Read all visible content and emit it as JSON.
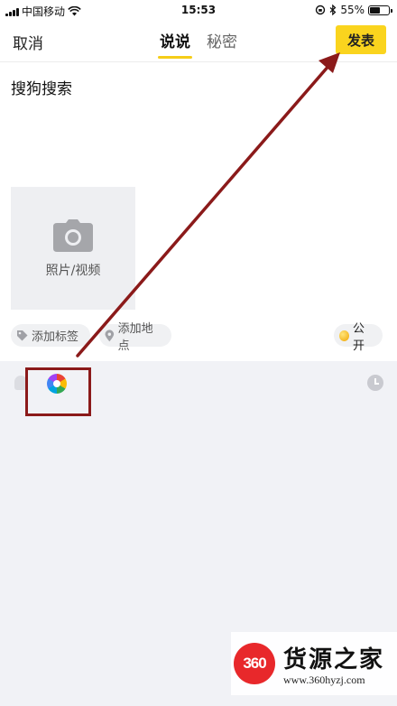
{
  "status_bar": {
    "carrier": "中国移动",
    "time": "15:53",
    "battery_text": "55%",
    "battery_level": 0.55
  },
  "nav": {
    "cancel_label": "取消",
    "tabs": [
      {
        "label": "说说",
        "active": true
      },
      {
        "label": "秘密",
        "active": false
      }
    ],
    "publish_label": "发表"
  },
  "post": {
    "text": "搜狗搜索"
  },
  "media": {
    "photo_label": "照片/视频"
  },
  "chips": {
    "tag_label": "添加标签",
    "location_label": "添加地点",
    "visibility_label": "公开"
  },
  "watermark": {
    "logo_text": "360",
    "name": "货源之家",
    "url": "www.360hyzj.com"
  },
  "colors": {
    "accent_yellow": "#fad41e",
    "annotation_red": "#8b1a1a",
    "panel_bg": "#f1f2f6"
  },
  "icons": [
    "wifi-icon",
    "lock-rotation-icon",
    "bluetooth-icon",
    "camera-icon",
    "tag-icon",
    "location-pin-icon",
    "globe-icon",
    "app-icon",
    "clock-icon"
  ]
}
